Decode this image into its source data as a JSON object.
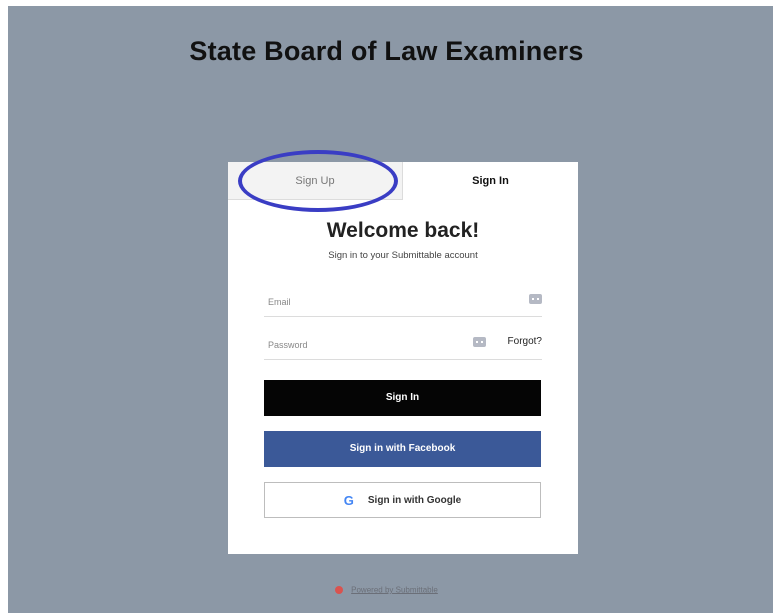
{
  "header": {
    "title": "State Board of Law Examiners"
  },
  "tabs": {
    "signup_label": "Sign Up",
    "signin_label": "Sign In",
    "active": "Sign In"
  },
  "welcome": {
    "heading": "Welcome back!",
    "subtitle": "Sign in to your Submittable account"
  },
  "form": {
    "email_placeholder": "Email",
    "email_value": "",
    "password_placeholder": "Password",
    "password_value": "",
    "forgot_label": "Forgot?"
  },
  "buttons": {
    "signin": "Sign In",
    "facebook": "Sign in with Facebook",
    "google": "Sign in with Google",
    "google_glyph": "G"
  },
  "footer": {
    "powered_by": "Powered by Submittable"
  },
  "colors": {
    "page_background": "#8c98a6",
    "highlight_circle": "#3a3dc4",
    "facebook_blue": "#3b5998",
    "signin_black": "#050505"
  },
  "icons": [
    "key-icon",
    "google-logo-icon",
    "submittable-logo-icon"
  ]
}
